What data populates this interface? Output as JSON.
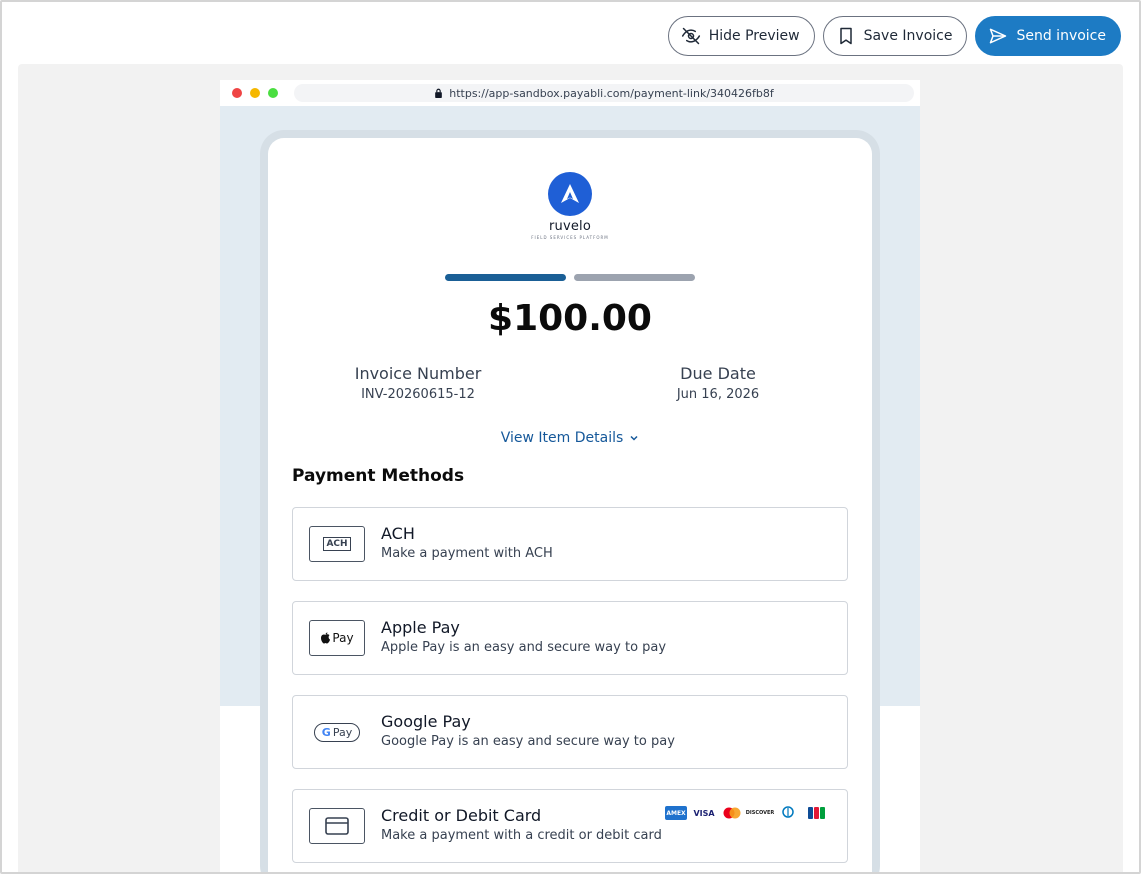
{
  "toolbar": {
    "hide_preview_label": "Hide Preview",
    "save_invoice_label": "Save Invoice",
    "send_invoice_label": "Send invoice"
  },
  "browser": {
    "url": "https://app-sandbox.payabli.com/payment-link/340426fb8f"
  },
  "invoice": {
    "brand_name": "ruvelo",
    "brand_tagline": "FIELD SERVICES PLATFORM",
    "progress_step": 1,
    "progress_total": 2,
    "amount": "$100.00",
    "invoice_number_label": "Invoice Number",
    "invoice_number": "INV-20260615-12",
    "due_date_label": "Due Date",
    "due_date": "Jun 16, 2026",
    "view_details_label": "View Item Details",
    "payment_methods_title": "Payment Methods",
    "methods": [
      {
        "name": "ACH",
        "description": "Make a payment with ACH",
        "logo": "ACH"
      },
      {
        "name": "Apple Pay",
        "description": "Apple Pay is an easy and secure way to pay",
        "logo": "Pay"
      },
      {
        "name": "Google Pay",
        "description": "Google Pay is an easy and secure way to pay",
        "logo": "Pay"
      },
      {
        "name": "Credit or Debit Card",
        "description": "Make a payment with a credit or debit card",
        "logo": "card-icon"
      }
    ],
    "card_brands": [
      "AMEX",
      "VISA",
      "mastercard",
      "DISCOVER",
      "Diners Club",
      "JCB"
    ]
  },
  "colors": {
    "primary": "#1d7bc4",
    "progress_active": "#1a5f96",
    "progress_inactive": "#9ca3af",
    "brand_logo": "#1f5fd6"
  }
}
